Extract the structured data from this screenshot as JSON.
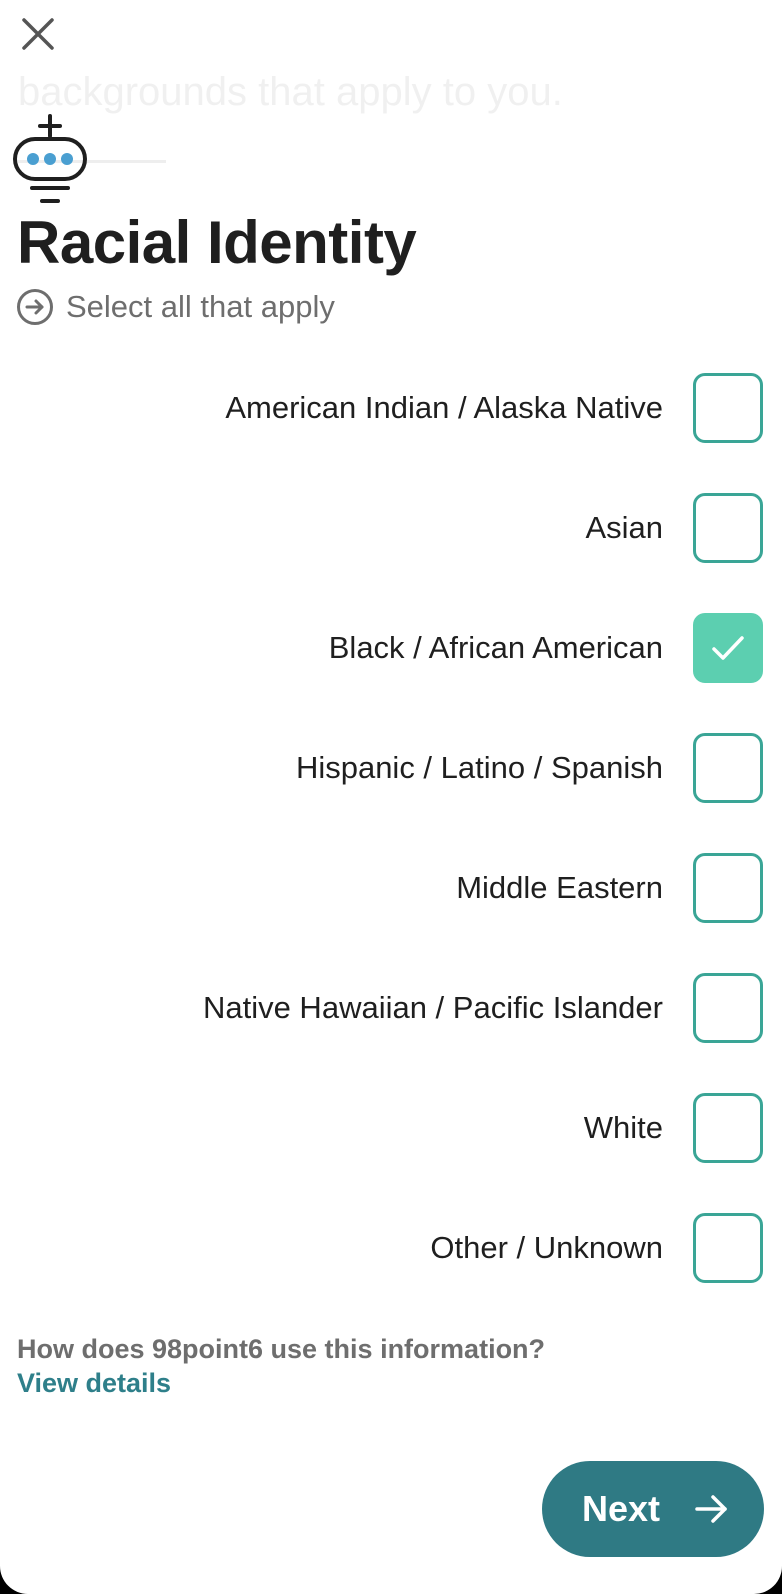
{
  "header": {
    "faded_text": "backgrounds that apply to you."
  },
  "title": "Racial Identity",
  "subtitle": "Select all that apply",
  "options": [
    {
      "label": "American Indian / Alaska Native",
      "checked": false
    },
    {
      "label": "Asian",
      "checked": false
    },
    {
      "label": "Black / African American",
      "checked": true
    },
    {
      "label": "Hispanic / Latino / Spanish",
      "checked": false
    },
    {
      "label": "Middle Eastern",
      "checked": false
    },
    {
      "label": "Native Hawaiian / Pacific Islander",
      "checked": false
    },
    {
      "label": "White",
      "checked": false
    },
    {
      "label": "Other / Unknown",
      "checked": false
    }
  ],
  "info": {
    "question": "How does 98point6 use this information?",
    "link": "View details"
  },
  "next_button": {
    "label": "Next"
  },
  "colors": {
    "accent": "#3aa596",
    "checked_fill": "#5ccfb0",
    "button": "#2f7a84",
    "link": "#2e7f8a",
    "logo_blue": "#4a9fd1"
  },
  "icons": {
    "close": "close-icon",
    "logo": "bot-logo-icon",
    "subtitle": "arrow-circle-icon",
    "check": "check-icon",
    "next": "arrow-right-icon"
  }
}
